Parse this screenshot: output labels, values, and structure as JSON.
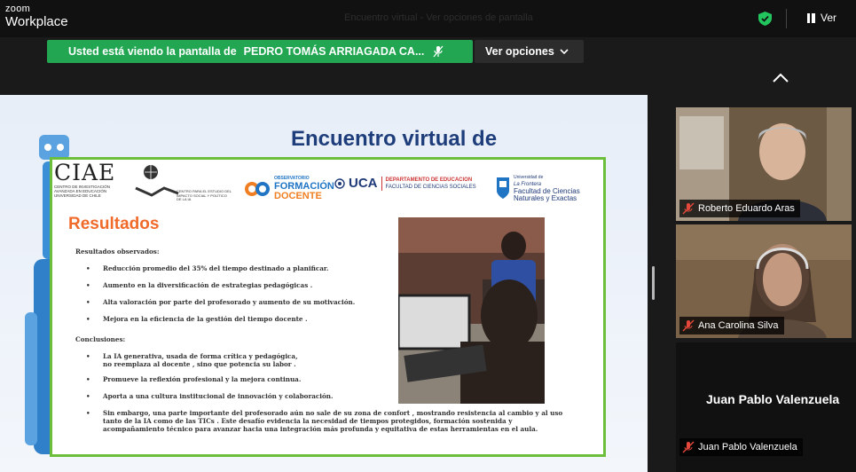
{
  "app": {
    "logo_top": "zoom",
    "logo_bottom": "Workplace",
    "meeting_title": "Encuentro virtual - Ver opciones de pantalla"
  },
  "header": {
    "view_label": "Ver"
  },
  "share_banner": {
    "prefix": "Usted está viendo la pantalla de",
    "presenter": "PEDRO TOMÁS ARRIAGADA CA...",
    "options_label": "Ver opciones"
  },
  "slide": {
    "title": "Encuentro virtual de",
    "logos": {
      "ciae_name": "CIAE",
      "ciae_sub": "CENTRO DE INVESTIGACIÓN AVANZADA EN EDUCACIÓN UNIVERSIDAD DE CHILE",
      "cepi_sub": "CENTRO PARA EL ESTUDIO DEL IMPACTO SOCIAL Y POLÍTICO DE LA IA",
      "obs_top": "OBSERVATORIO",
      "obs_mid": "FORMACIÓN",
      "obs_bottom": "DOCENTE",
      "uca": "UCA",
      "uca_dept": "DEPARTAMENTO DE EDUCACION",
      "uca_fac": "FACULTAD DE CIENCIAS SOCIALES",
      "ufro_top": "Universidad de",
      "ufro_name": "La Frontera",
      "ufro_fac": "Facultad de Ciencias Naturales y Exactas"
    },
    "section_title": "Resultados",
    "observed_heading": "Resultados observados:",
    "observed": [
      "Reducción promedio del 35% del tiempo  destinado a planificar.",
      "Aumento en la diversificación de estrategias pedagógicas     .",
      "Alta valoración por parte del profesorado y aumento de su motivación.",
      "Mejora en la eficiencia de la gestión del tiempo docente     ."
    ],
    "conclusions_heading": "Conclusiones:",
    "conclusions": [
      "La IA generativa, usada de forma crítica y pedagógica, no reemplaza al docente  , sino que potencia su labor  .",
      "Promueve la reflexión profesional y la mejora continua.",
      "Aporta a una cultura institucional de innovación y colaboración.",
      "Sin embargo, una parte importante del profesorado aún no sale de su zona de confort     , mostrando resistencia al cambio y al uso tanto de la IA como de las TICs     . Este desafío evidencia la necesidad de tiempos protegidos, formación sostenida y acompañamiento técnico para avanzar hacia una integración más profunda y equitativa de estas herramientas en el aula."
    ]
  },
  "participants": [
    {
      "name": "Roberto Eduardo Aras",
      "muted": true
    },
    {
      "name": "Ana Carolina Silva",
      "muted": true
    },
    {
      "name": "Juan Pablo Valenzuela",
      "muted": true,
      "display_name": "Juan Pablo Valenzuela"
    }
  ],
  "colors": {
    "banner_green": "#22a652",
    "muted_red": "#e5483a",
    "accent_orange": "#f06a2a",
    "frame_green": "#6bbf3b"
  }
}
